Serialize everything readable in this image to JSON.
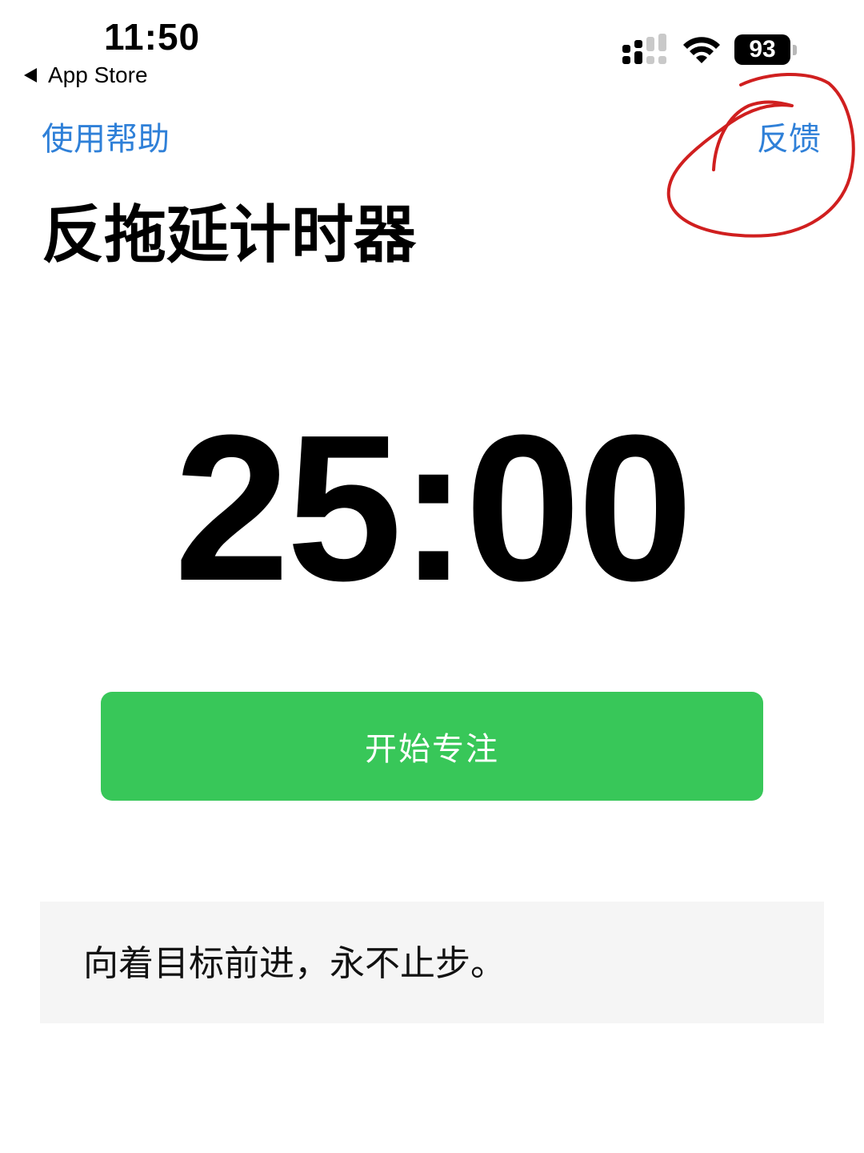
{
  "status_bar": {
    "time": "11:50",
    "back_label": "App Store",
    "battery_level": "93"
  },
  "nav": {
    "help_label": "使用帮助",
    "feedback_label": "反馈"
  },
  "title": "反拖延计时器",
  "timer": {
    "display": "25:00"
  },
  "start_button": {
    "label": "开始专注"
  },
  "quote": {
    "text": "向着目标前进，永不止步。"
  },
  "colors": {
    "link_blue": "#2f80d8",
    "button_green": "#38c759",
    "annotation_red": "#d01f1f",
    "quote_background": "#f5f5f5"
  },
  "icons": {
    "back": "back-arrow-icon",
    "signal": "cellular-signal-icon",
    "wifi": "wifi-icon",
    "battery": "battery-icon"
  }
}
